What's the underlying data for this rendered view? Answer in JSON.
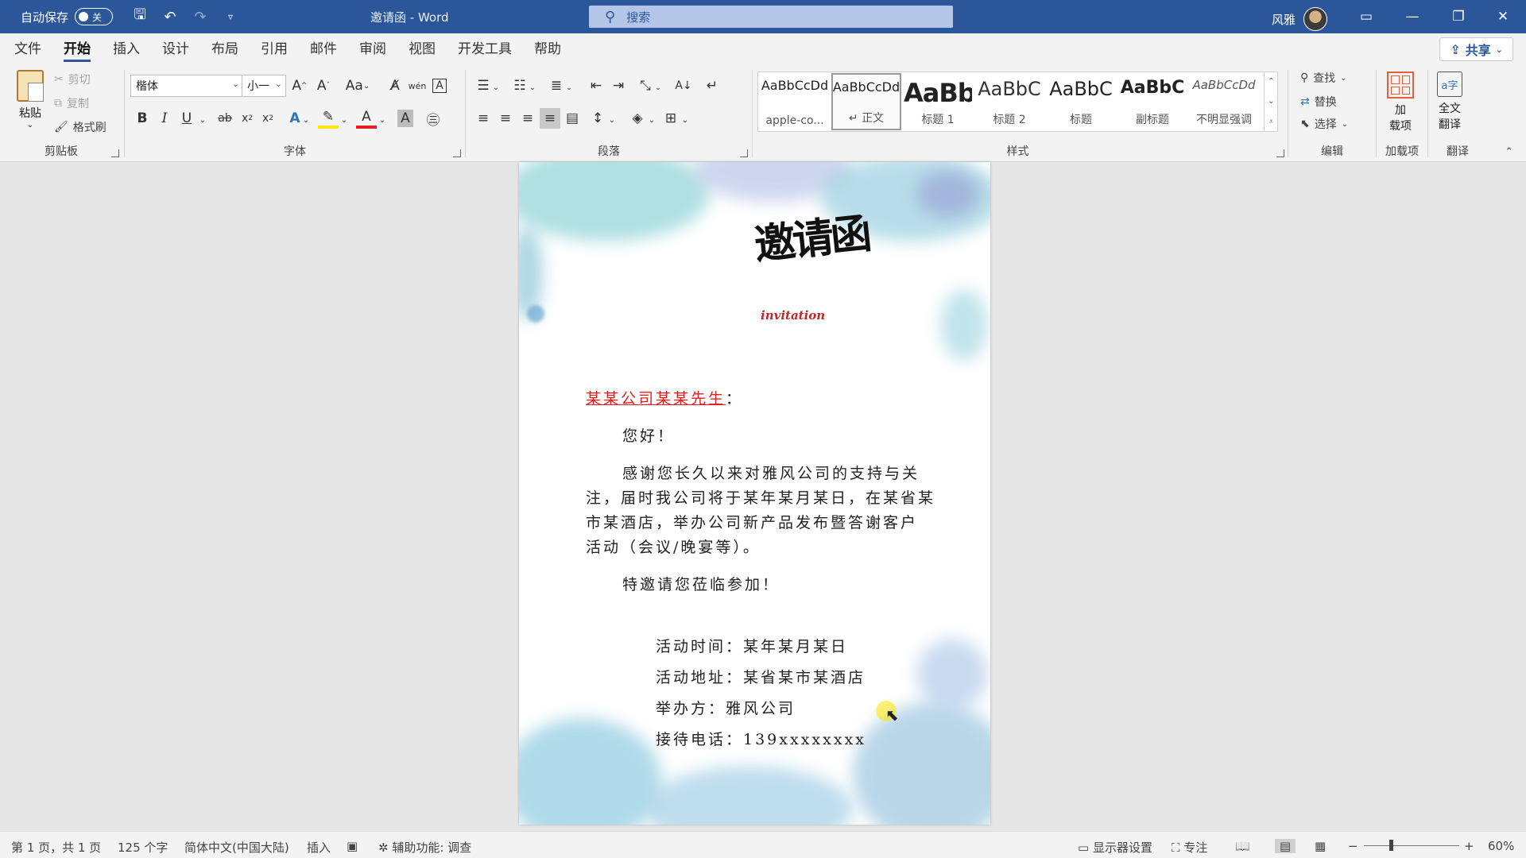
{
  "titlebar": {
    "autosave_label": "自动保存",
    "autosave_state": "关",
    "doc_title": "邀请函 - Word",
    "search_placeholder": "搜索",
    "user_name": "风雅"
  },
  "tabs": [
    "文件",
    "开始",
    "插入",
    "设计",
    "布局",
    "引用",
    "邮件",
    "审阅",
    "视图",
    "开发工具",
    "帮助"
  ],
  "active_tab": "开始",
  "share_label": "共享",
  "ribbon": {
    "clipboard": {
      "label": "剪贴板",
      "paste": "粘贴",
      "cut": "剪切",
      "copy": "复制",
      "format_painter": "格式刷"
    },
    "font": {
      "label": "字体",
      "font_name": "楷体",
      "font_size": "小一",
      "aa": "Aa"
    },
    "paragraph": {
      "label": "段落"
    },
    "styles": {
      "label": "样式",
      "items": [
        {
          "preview": "AaBbCcDd",
          "name": "apple-co..."
        },
        {
          "preview": "AaBbCcDd",
          "name": "↵ 正文"
        },
        {
          "preview": "AaBb",
          "name": "标题 1"
        },
        {
          "preview": "AaBbC",
          "name": "标题 2"
        },
        {
          "preview": "AaBbC",
          "name": "标题"
        },
        {
          "preview": "AaBbC",
          "name": "副标题"
        },
        {
          "preview": "AaBbCcDd",
          "name": "不明显强调"
        }
      ]
    },
    "editing": {
      "label": "编辑",
      "find": "查找",
      "replace": "替换",
      "select": "选择"
    },
    "addins": {
      "label": "加载项",
      "btn_line1": "加",
      "btn_line2": "载项"
    },
    "translate": {
      "label": "翻译",
      "btn_line1": "全文",
      "btn_line2": "翻译"
    }
  },
  "document": {
    "logo_text_main": "邀请函",
    "logo_text_sub": "invitation",
    "salutation": "某某公司某某先生",
    "colon": "：",
    "greeting": "您好！",
    "body_lines": [
      "感谢您长久以来对雅风公司的支持与关",
      "注，届时我公司将于某年某月某日，在某省某",
      "市某酒店，举办公司新产品发布暨答谢客户",
      "活动（会议/晚宴等）。"
    ],
    "invite": "特邀请您莅临参加！",
    "details": [
      "活动时间：某年某月某日",
      "活动地址：某省某市某酒店",
      "举办方：雅风公司",
      "接待电话：139xxxxxxxx"
    ]
  },
  "status": {
    "page": "第 1 页，共 1 页",
    "words": "125 个字",
    "language": "简体中文(中国大陆)",
    "mode": "插入",
    "accessibility": "辅助功能: 调查",
    "display_settings": "显示器设置",
    "focus": "专注",
    "zoom": "60%"
  },
  "colors": {
    "titlebar": "#2b579a",
    "salutation": "#e02020"
  }
}
